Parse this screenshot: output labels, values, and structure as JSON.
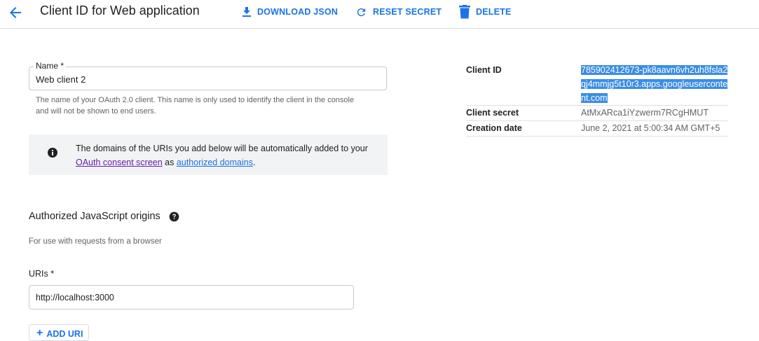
{
  "header": {
    "title": "Client ID for Web application",
    "actions": {
      "download": "DOWNLOAD JSON",
      "reset": "RESET SECRET",
      "delete": "DELETE"
    }
  },
  "name_field": {
    "label": "Name *",
    "value": "Web client 2",
    "helper": "The name of your OAuth 2.0 client. This name is only used to identify the client in the console and will not be shown to end users."
  },
  "info": {
    "text_before": "The domains of the URIs you add below will be automatically added to your ",
    "link1": "OAuth consent screen",
    "text_mid": " as ",
    "link2": "authorized domains",
    "text_after": "."
  },
  "origins": {
    "title": "Authorized JavaScript origins",
    "subtitle": "For use with requests from a browser",
    "uris_label": "URIs *",
    "uri_value": "http://localhost:3000",
    "add_button": "ADD URI"
  },
  "details": {
    "client_id_label": "Client ID",
    "client_id_value": "785902412673-pk8aavn6vh2uh8fsla2qj4mmjg5t10r3.apps.googleusercontent.com",
    "client_secret_label": "Client secret",
    "client_secret_value": "AtMxARca1iYzwerm7RCgHMUT",
    "creation_date_label": "Creation date",
    "creation_date_value": "June 2, 2021 at 5:00:34 AM GMT+5"
  },
  "colors": {
    "accent": "#1a73e8",
    "visited_link": "#681da8",
    "selection": "#3a8de6"
  },
  "icons": {
    "back": "arrow-back-icon",
    "download": "download-icon",
    "reset": "refresh-icon",
    "delete": "trash-icon",
    "info": "info-icon",
    "help": "help-icon",
    "add": "plus-icon"
  }
}
